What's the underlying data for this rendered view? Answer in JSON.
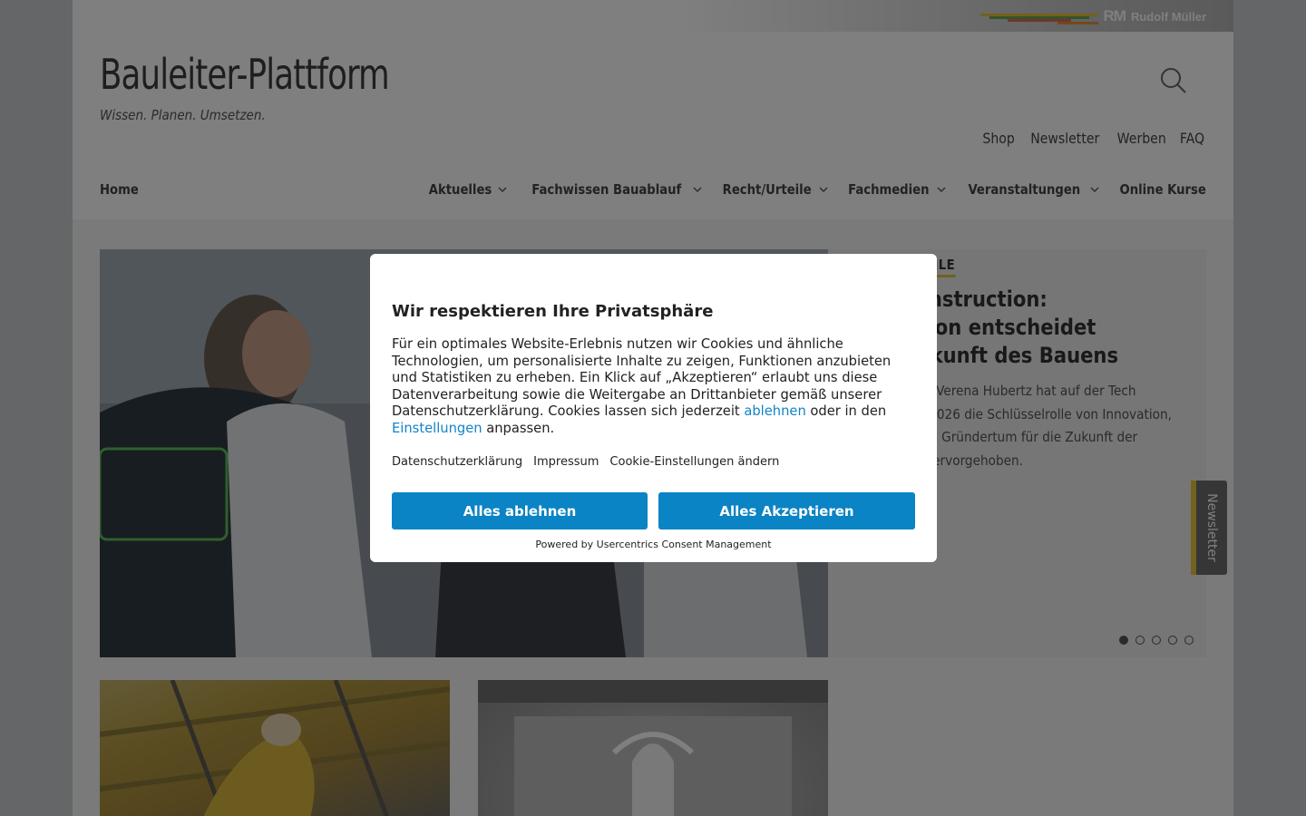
{
  "brand": {
    "publisher_mark": "RM",
    "publisher_name": "Rudolf Müller",
    "stripe_colors": [
      "#e3c53a",
      "#6aa84f",
      "#e06666",
      "#e69138"
    ]
  },
  "header": {
    "site_title": "Bauleiter-Plattform",
    "tagline": "Wissen. Planen. Umsetzen.",
    "search_icon": "search-icon",
    "utility_links": [
      "Shop",
      "Newsletter",
      "Werben",
      "FAQ"
    ]
  },
  "nav": {
    "home": "Home",
    "items": [
      {
        "label": "Aktuelles",
        "dropdown": true
      },
      {
        "label": "Fachwissen Bauablauf",
        "dropdown": true
      },
      {
        "label": "Recht/Urteile",
        "dropdown": true
      },
      {
        "label": "Fachmedien",
        "dropdown": true
      },
      {
        "label": "Veranstaltungen",
        "dropdown": true
      },
      {
        "label": "Online Kurse",
        "dropdown": false
      }
    ]
  },
  "hero": {
    "category": "RECHT/URTEILE",
    "title": "Tech Construction: Innovation entscheidet über Zukunft des Bauens",
    "text": "Bauministerin Verena Hubertz hat auf der Tech Construction 2026 die Schlüsselrolle von Innovation, Forschung und Gründertum für die Zukunft der Baubranche hervorgehoben.",
    "slides_total": 5,
    "active_slide": 1
  },
  "side_tab": {
    "label": "Newsletter"
  },
  "consent": {
    "title": "Wir respektieren Ihre Privatsphäre",
    "message_part1": "Für ein optimales Website-Erlebnis nutzen wir Cookies und ähnliche Technologien, um personalisierte Inhalte zu zeigen, Funktionen anzubieten und Statistiken zu erheben. Ein Klick auf „Akzeptieren“ erlaubt uns diese Datenverarbeitung sowie die Weitergabe an Drittanbieter gemäß unserer Datenschutzerklärung. Cookies lassen sich jederzeit",
    "link_deny": "ablehnen",
    "message_part2": "oder in den",
    "link_settings": "Einstellungen",
    "message_part3": "anpassen.",
    "footer_links": [
      "Datenschutzerklärung",
      "Impressum",
      "Cookie-Einstellungen ändern"
    ],
    "deny_button": "Alles ablehnen",
    "accept_button": "Alles Akzeptieren",
    "powered_by": "Powered by Usercentrics Consent Management",
    "accent_color": "#0a84c4"
  }
}
